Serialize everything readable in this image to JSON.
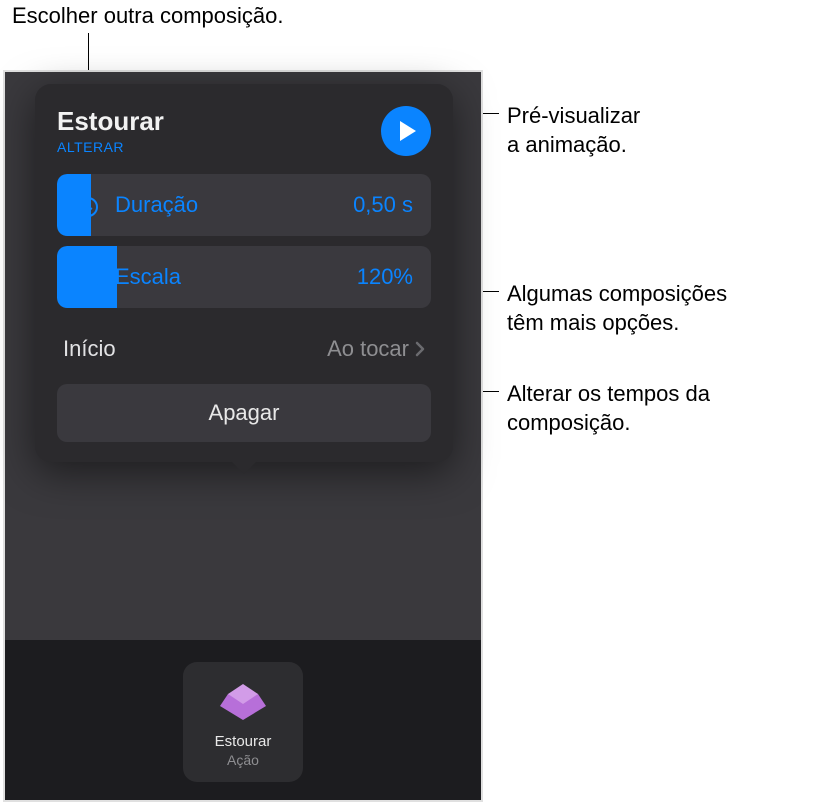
{
  "callouts": {
    "change": "Escolher outra composição.",
    "preview": "Pré-visualizar\na animação.",
    "options": "Algumas composições\ntêm mais opções.",
    "timing": "Alterar os tempos da\ncomposição."
  },
  "popover": {
    "title": "Estourar",
    "change_label": "ALTERAR",
    "duration": {
      "label": "Duração",
      "value": "0,50 s"
    },
    "scale": {
      "label": "Escala",
      "value": "120%"
    },
    "start": {
      "label": "Início",
      "value": "Ao tocar"
    },
    "delete_label": "Apagar"
  },
  "chip": {
    "title": "Estourar",
    "subtitle": "Ação"
  }
}
